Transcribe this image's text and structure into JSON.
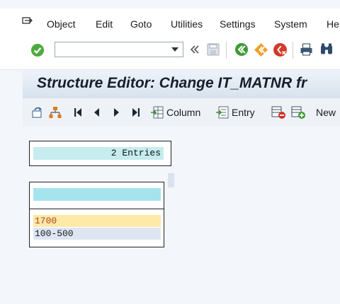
{
  "menu": {
    "items": [
      "Object",
      "Edit",
      "Goto",
      "Utilities",
      "Settings",
      "System",
      "He"
    ]
  },
  "toolbar": {
    "command_value": "",
    "icons": [
      "enter-icon",
      "command-dropdown-icon",
      "history-icon",
      "save-icon",
      "back-icon",
      "exit-icon",
      "cancel-icon",
      "print-icon",
      "find-icon"
    ]
  },
  "title": "Structure Editor: Change IT_MATNR fr",
  "app_toolbar": {
    "column_label": "Column",
    "entry_label": "Entry",
    "new_label": "New"
  },
  "entries": {
    "text": "2 Entries"
  },
  "table": {
    "rows": [
      "1700",
      "100-500"
    ]
  },
  "colors": {
    "highlight_row": "#fde9a8",
    "highlight_text": "#b0421c",
    "header_cyan": "#a6e4ed"
  }
}
